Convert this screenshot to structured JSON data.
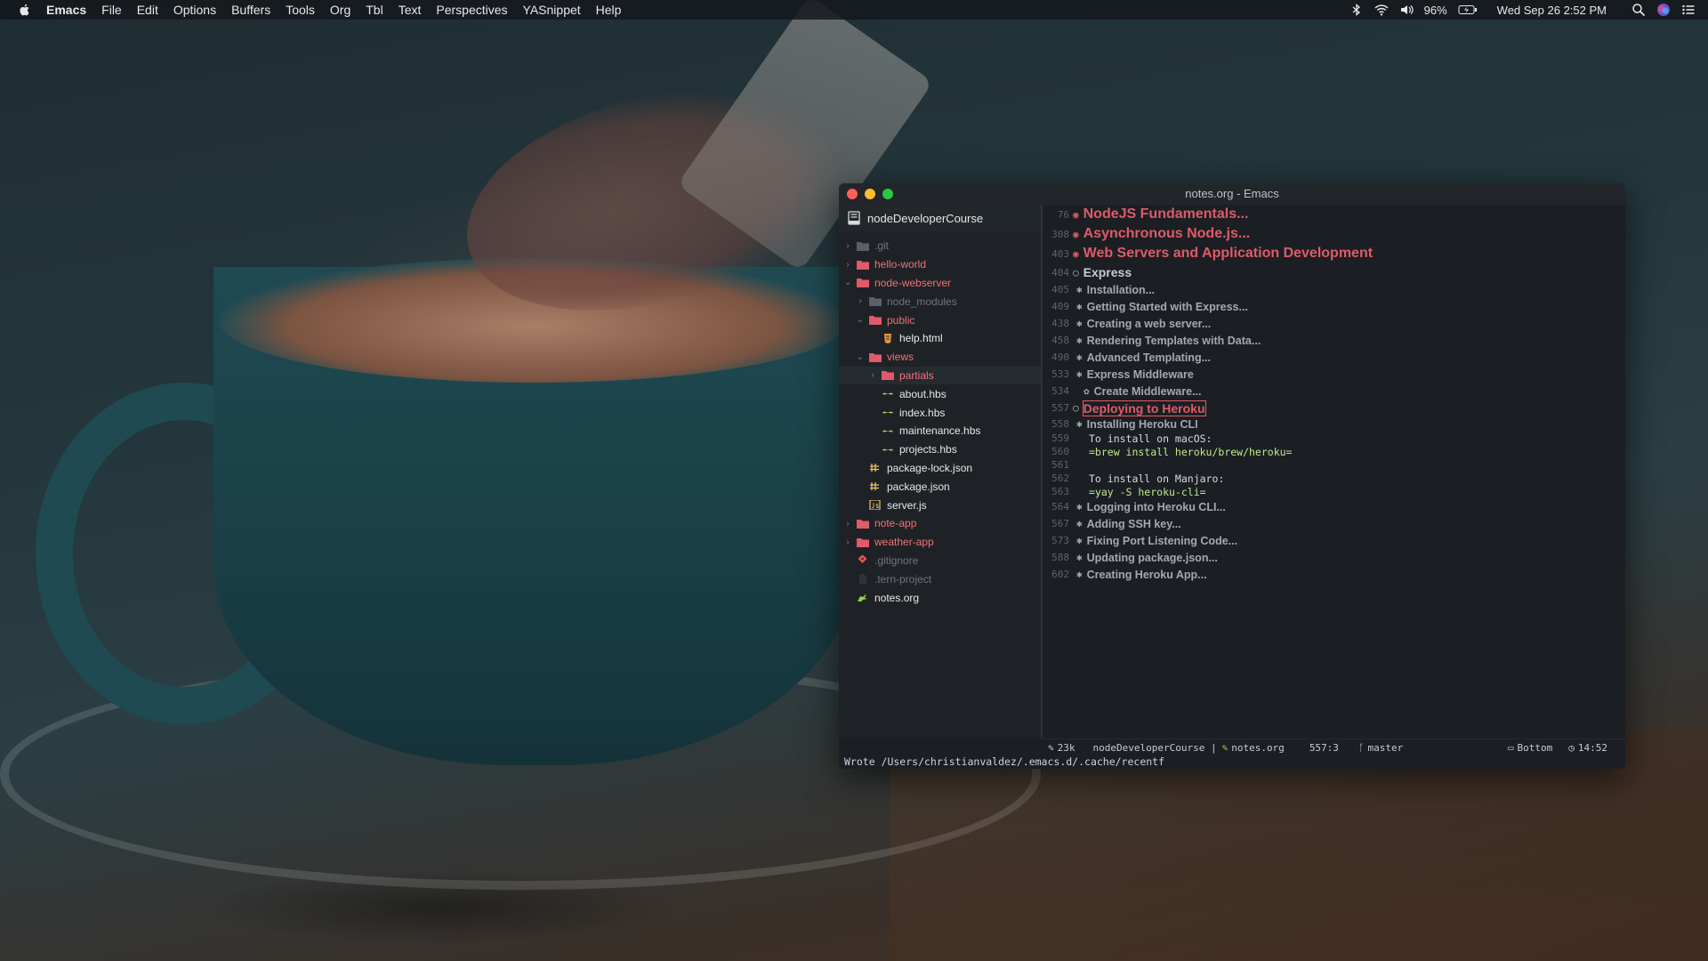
{
  "menubar": {
    "app": "Emacs",
    "items": [
      "File",
      "Edit",
      "Options",
      "Buffers",
      "Tools",
      "Org",
      "Tbl",
      "Text",
      "Perspectives",
      "YASnippet",
      "Help"
    ],
    "battery": "96%",
    "datetime": "Wed Sep 26  2:52 PM"
  },
  "window": {
    "title": "notes.org - Emacs"
  },
  "sidebar": {
    "project": "nodeDeveloperCourse",
    "items": [
      {
        "label": ".git"
      },
      {
        "label": "hello-world"
      },
      {
        "label": "node-webserver"
      },
      {
        "label": "node_modules"
      },
      {
        "label": "public"
      },
      {
        "label": "help.html"
      },
      {
        "label": "views"
      },
      {
        "label": "partials"
      },
      {
        "label": "about.hbs"
      },
      {
        "label": "index.hbs"
      },
      {
        "label": "maintenance.hbs"
      },
      {
        "label": "projects.hbs"
      },
      {
        "label": "package-lock.json"
      },
      {
        "label": "package.json"
      },
      {
        "label": "server.js"
      },
      {
        "label": "note-app"
      },
      {
        "label": "weather-app"
      },
      {
        "label": ".gitignore"
      },
      {
        "label": ".tern-project"
      },
      {
        "label": "notes.org"
      }
    ]
  },
  "editor": {
    "lines": [
      {
        "num": "76",
        "text": "NodeJS Fundamentals..."
      },
      {
        "num": "308",
        "text": "Asynchronous Node.js..."
      },
      {
        "num": "403",
        "text": "Web Servers and Application Development"
      },
      {
        "num": "404",
        "text": "Express"
      },
      {
        "num": "405",
        "text": "Installation..."
      },
      {
        "num": "409",
        "text": "Getting Started with Express..."
      },
      {
        "num": "438",
        "text": "Creating a web server..."
      },
      {
        "num": "458",
        "text": "Rendering Templates with Data..."
      },
      {
        "num": "490",
        "text": "Advanced Templating..."
      },
      {
        "num": "533",
        "text": "Express Middleware"
      },
      {
        "num": "534",
        "text": "Create Middleware..."
      },
      {
        "num": "557",
        "text": "Deploying to Heroku"
      },
      {
        "num": "558",
        "text": "Installing Heroku CLI"
      },
      {
        "num": "559",
        "text": "To install on macOS:"
      },
      {
        "num": "560",
        "text": "=brew install heroku/brew/heroku="
      },
      {
        "num": "561",
        "text": ""
      },
      {
        "num": "562",
        "text": "To install on Manjaro:"
      },
      {
        "num": "563",
        "text": "=yay -S heroku-cli="
      },
      {
        "num": "564",
        "text": "Logging into Heroku CLI..."
      },
      {
        "num": "567",
        "text": "Adding SSH key..."
      },
      {
        "num": "573",
        "text": "Fixing Port Listening Code..."
      },
      {
        "num": "588",
        "text": "Updating package.json..."
      },
      {
        "num": "602",
        "text": "Creating Heroku App..."
      }
    ]
  },
  "modeline": {
    "size": "23k",
    "project": "nodeDeveloperCourse |",
    "buffer": "notes.org",
    "position": "557:3",
    "branch": "master",
    "scroll": "Bottom",
    "time": "14:52"
  },
  "minibuffer": {
    "message": "Wrote /Users/christianvaldez/.emacs.d/.cache/recentf"
  },
  "colors": {
    "heading1": "#e05a6a",
    "folder": "#f07178",
    "code": "#c3e88d",
    "background": "#1b1f23"
  }
}
